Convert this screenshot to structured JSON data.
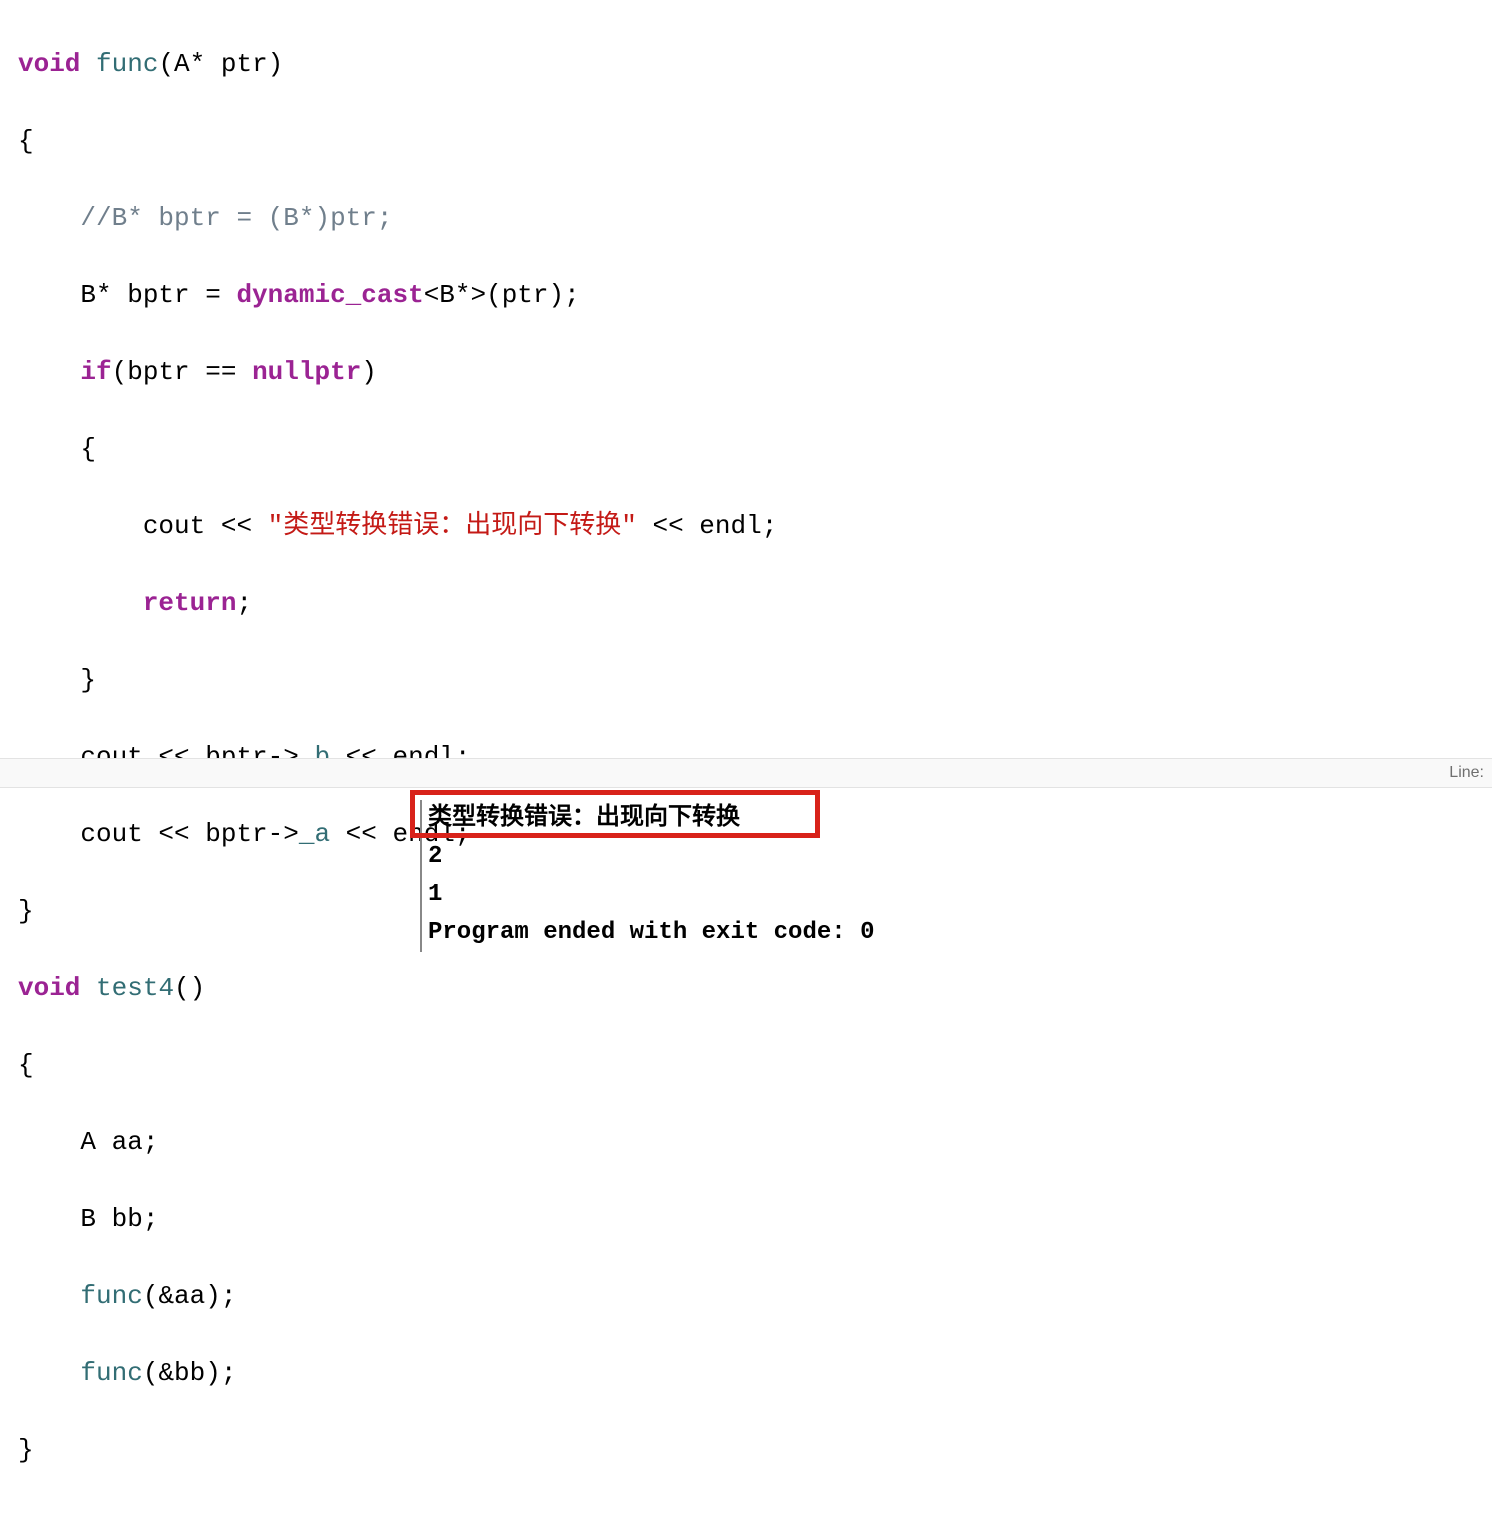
{
  "code": {
    "l1": {
      "kw1": "void",
      "fn": "func",
      "rest": "(A* ptr)"
    },
    "l2": "{",
    "l3": {
      "indent": "    ",
      "comment": "//B* bptr = (B*)ptr;"
    },
    "l4": {
      "indent": "    ",
      "t1": "B* bptr = ",
      "kw": "dynamic_cast",
      "t2": "<B*>(ptr);"
    },
    "l5": {
      "indent": "    ",
      "kw1": "if",
      "t1": "(bptr == ",
      "kw2": "nullptr",
      "t2": ")"
    },
    "l6": {
      "indent": "    ",
      "t": "{"
    },
    "l7": {
      "indent": "        ",
      "t1": "cout << ",
      "str": "\"类型转换错误：出现向下转换\"",
      "t2": " << endl;"
    },
    "l8": {
      "indent": "        ",
      "kw": "return",
      "t": ";"
    },
    "l9": {
      "indent": "    ",
      "t": "}"
    },
    "l10": {
      "indent": "    ",
      "t1": "cout << bptr->",
      "m": "_b",
      "t2": " << endl;"
    },
    "l11": {
      "indent": "    ",
      "t1": "cout << bptr->",
      "m": "_a",
      "t2": " << endl;"
    },
    "l12": "}",
    "l13": {
      "kw1": "void",
      "fn": "test4",
      "rest": "()"
    },
    "l14": "{",
    "l15": {
      "indent": "    ",
      "t": "A aa;"
    },
    "l16": {
      "indent": "    ",
      "t": "B bb;"
    },
    "l17": {
      "indent": "    ",
      "fn": "func",
      "t": "(&aa);"
    },
    "l18": {
      "indent": "    ",
      "fn": "func",
      "t": "(&bb);"
    },
    "l19": "}"
  },
  "status": {
    "line_label": "Line:"
  },
  "console": {
    "out1": "类型转换错误：出现向下转换",
    "out2": "2",
    "out3": "1",
    "out4": "Program ended with exit code: 0"
  }
}
